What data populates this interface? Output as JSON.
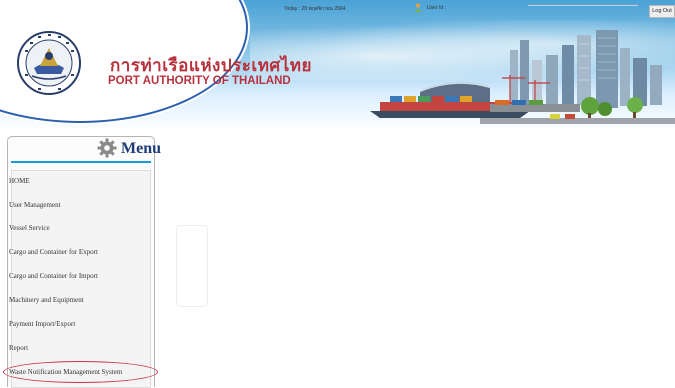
{
  "topbar": {
    "today": "Today : 28 พฤศจิกายน 2564",
    "user_id_label": "User Id :",
    "logout_label": "Log Out"
  },
  "brand": {
    "thai_name": "การท่าเรือแห่งประเทศไทย",
    "english_name": "PORT AUTHORITY OF THAILAND",
    "seal_icon": "port-authority-seal-logo",
    "accent_color": "#b8323d"
  },
  "menu": {
    "title": "Menu",
    "icon": "gear-icon",
    "items": [
      {
        "label": "HOME"
      },
      {
        "label": "User Management"
      },
      {
        "label": "Vessel Service"
      },
      {
        "label": "Cargo and Container for Export"
      },
      {
        "label": "Cargo and Container for Import"
      },
      {
        "label": "Machinery and Equipment"
      },
      {
        "label": "Payment Import/Export"
      },
      {
        "label": "Report"
      },
      {
        "label": "Waste Notification Management System"
      }
    ],
    "highlight_color": "#cc3344"
  }
}
